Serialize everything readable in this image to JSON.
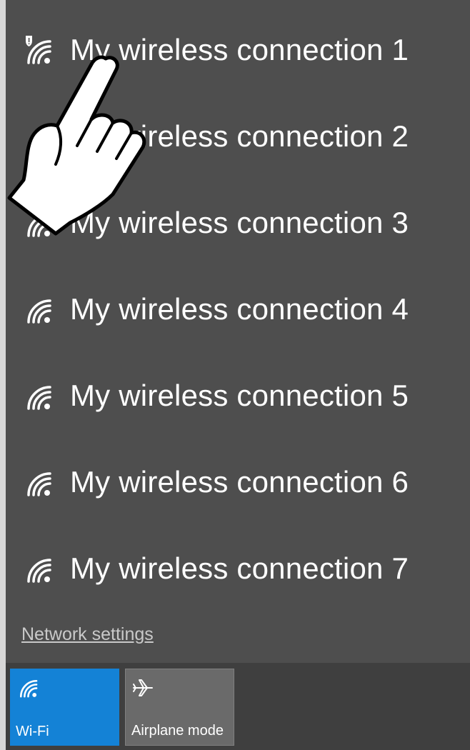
{
  "networks": [
    {
      "name": "My wireless connection 1",
      "icon": "wifi-secured-warning-icon"
    },
    {
      "name": "My wireless connection 2",
      "icon": "wifi-icon"
    },
    {
      "name": "My wireless connection 3",
      "icon": "wifi-icon"
    },
    {
      "name": "My wireless connection 4",
      "icon": "wifi-icon"
    },
    {
      "name": "My wireless connection 5",
      "icon": "wifi-icon"
    },
    {
      "name": "My wireless connection 6",
      "icon": "wifi-icon"
    },
    {
      "name": "My wireless connection 7",
      "icon": "wifi-icon"
    }
  ],
  "network_settings_label": "Network settings",
  "quick_actions": {
    "wifi_label": "Wi-Fi",
    "airplane_label": "Airplane mode"
  },
  "colors": {
    "panel_bg": "#4e4e4e",
    "accent": "#1482d6",
    "text": "#ffffff"
  }
}
